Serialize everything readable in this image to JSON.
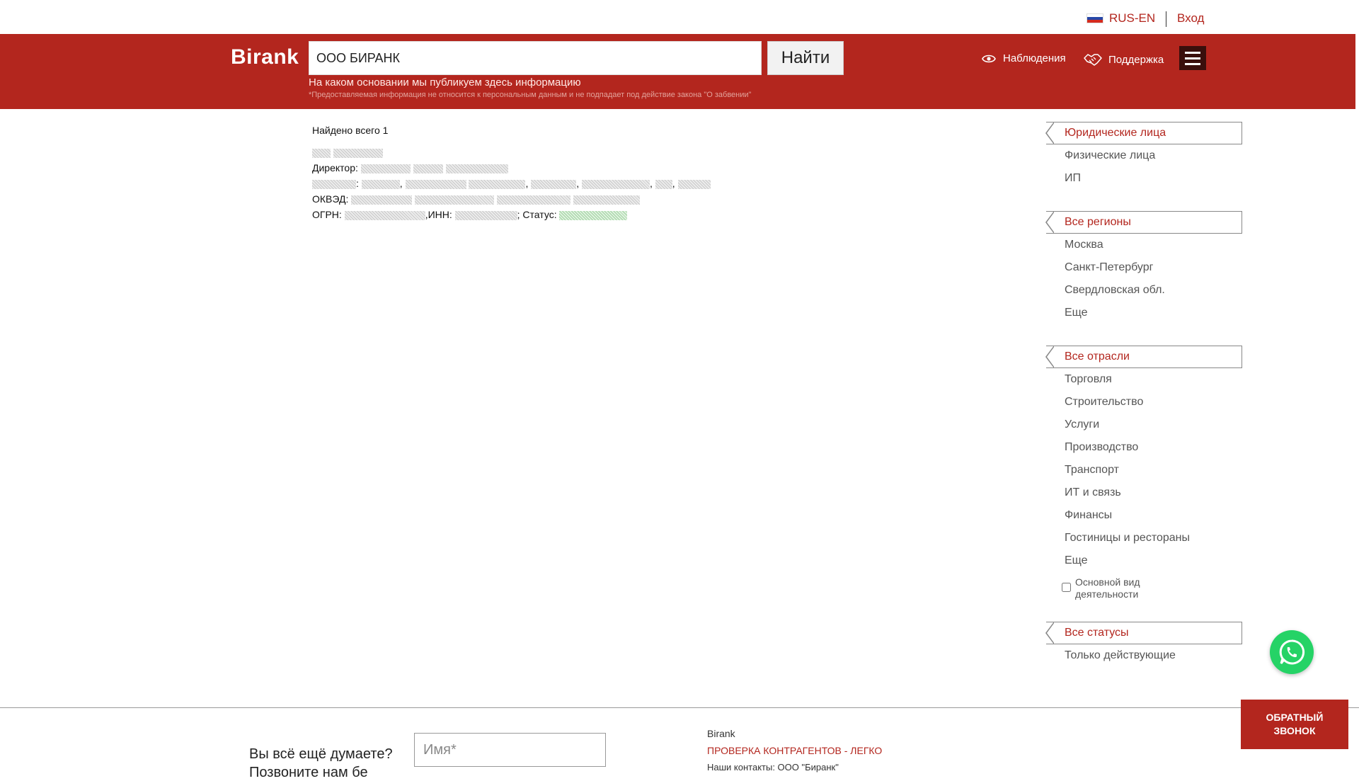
{
  "topbar": {
    "lang_label": "RUS-EN",
    "login_label": "Вход"
  },
  "header": {
    "logo": "Birank",
    "search_value": "ООО БИРАНК",
    "search_button": "Найти",
    "basis_link": "На каком основании мы публикуем здесь информацию",
    "disclaimer": "*Предоставляемая информация не относится к персональным данным и не подпадает под действие закона \"О забвении\"",
    "nav_watch": "Наблюдения",
    "nav_support": "Поддержка"
  },
  "results": {
    "found_label": "Найдено всего 1",
    "director_label": "Директор:",
    "okved_label": "ОКВЭД:",
    "ogrn_label": "ОГРН:",
    "inn_label": ",ИНН:",
    "status_label": "; Статус:"
  },
  "sidebar": {
    "entity_head": "Юридические лица",
    "entity_items": [
      "Физические лица",
      "ИП"
    ],
    "region_head": "Все регионы",
    "region_items": [
      "Москва",
      "Санкт-Петербург",
      "Свердловская обл.",
      "Еще"
    ],
    "industry_head": "Все отрасли",
    "industry_items": [
      "Торговля",
      "Строительство",
      "Услуги",
      "Производство",
      "Транспорт",
      "ИТ и связь",
      "Финансы",
      "Гостиницы и рестораны",
      "Еще"
    ],
    "main_activity_label": "Основной вид деятельности",
    "status_head": "Все статусы",
    "status_items": [
      "Только действующие"
    ]
  },
  "footer": {
    "question": "Вы всё ещё думаете?",
    "question_cont": "Позвоните нам бе",
    "name_placeholder": "Имя*",
    "brand": "Birank",
    "tagline": "ПРОВЕРКА КОНТРАГЕНТОВ - ЛЕГКО",
    "contacts": "Наши контакты: ООО \"Биранк\"",
    "callback_label": "ОБРАТНЫЙ\nЗВОНОК"
  },
  "colors": {
    "brand_red": "#b3261e",
    "whatsapp_green": "#25d366"
  }
}
